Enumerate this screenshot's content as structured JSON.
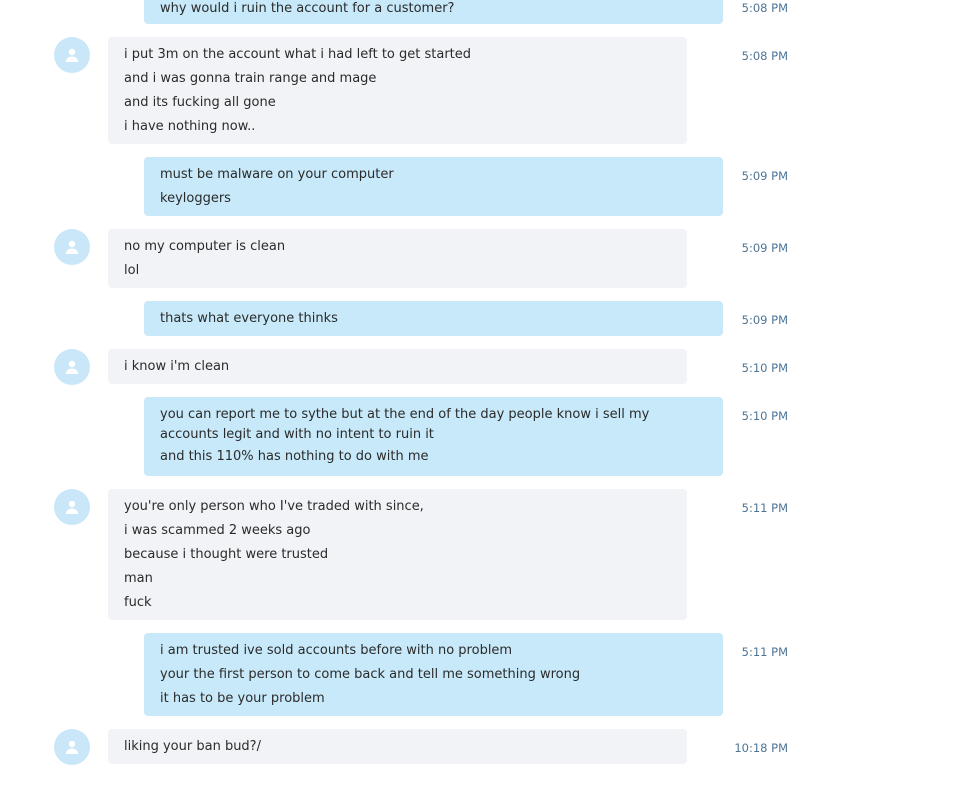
{
  "messages": [
    {
      "side": "out",
      "lines": [
        "why would i ruin the account for a customer?"
      ],
      "time": "5:08 PM"
    },
    {
      "side": "in",
      "lines": [
        "i put 3m on the account what i had left to get started",
        "and i was gonna train range and mage",
        "and its fucking all gone",
        "i have nothing now.."
      ],
      "time": "5:08 PM"
    },
    {
      "side": "out",
      "lines": [
        "must be malware on your computer",
        "keyloggers"
      ],
      "time": "5:09 PM"
    },
    {
      "side": "in",
      "lines": [
        "no my computer is clean",
        "lol"
      ],
      "time": "5:09 PM"
    },
    {
      "side": "out",
      "lines": [
        "thats what everyone thinks"
      ],
      "time": "5:09 PM"
    },
    {
      "side": "in",
      "lines": [
        "i know i'm clean"
      ],
      "time": "5:10 PM"
    },
    {
      "side": "out",
      "lines": [
        "you can report me to sythe but at the end of the day people know i sell my accounts legit and with no intent to ruin it",
        "and this 110% has nothing to do with me"
      ],
      "time": "5:10 PM"
    },
    {
      "side": "in",
      "lines": [
        "you're only person who I've traded with since,",
        "i was scammed 2 weeks ago",
        "because i thought were trusted",
        "man",
        "fuck"
      ],
      "time": "5:11 PM"
    },
    {
      "side": "out",
      "lines": [
        "i am trusted ive sold accounts before with no problem",
        "your the first person to come back and tell me something wrong",
        "it has to be your problem"
      ],
      "time": "5:11 PM"
    },
    {
      "side": "in",
      "lines": [
        "liking your ban bud?/"
      ],
      "time": "10:18 PM"
    }
  ],
  "icons": {
    "avatar": "person-icon"
  },
  "colors": {
    "incoming_bubble": "#f1f3f6",
    "outgoing_bubble": "#c7e9f9",
    "avatar": "#c9e7f8",
    "timestamp": "#4d7596"
  }
}
